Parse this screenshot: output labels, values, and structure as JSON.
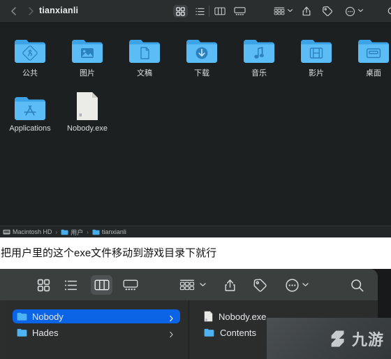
{
  "top_window": {
    "toolbar": {
      "back_icon": "chevron-left-icon",
      "forward_icon": "chevron-right-icon",
      "title": "tianxianli",
      "buttons": [
        {
          "name": "icon-view-button",
          "icon": "grid-view-icon",
          "selected": true
        },
        {
          "name": "list-view-button",
          "icon": "list-view-icon",
          "selected": false
        },
        {
          "name": "column-view-button",
          "icon": "column-view-icon",
          "selected": false
        },
        {
          "name": "gallery-view-button",
          "icon": "gallery-view-icon",
          "selected": false
        },
        {
          "name": "group-by-button",
          "icon": "group-by-icon",
          "selected": false
        },
        {
          "name": "share-button",
          "icon": "share-icon",
          "selected": false
        },
        {
          "name": "tag-button",
          "icon": "tag-icon",
          "selected": false
        },
        {
          "name": "more-button",
          "icon": "ellipsis-circle-icon",
          "selected": false
        },
        {
          "name": "search-button",
          "icon": "search-icon",
          "selected": false
        }
      ]
    },
    "items_row1": [
      {
        "label": "公共",
        "icon": "folder-public-icon"
      },
      {
        "label": "图片",
        "icon": "folder-pictures-icon"
      },
      {
        "label": "文稿",
        "icon": "folder-documents-icon"
      },
      {
        "label": "下载",
        "icon": "folder-downloads-icon"
      },
      {
        "label": "音乐",
        "icon": "folder-music-icon"
      },
      {
        "label": "影片",
        "icon": "folder-movies-icon"
      },
      {
        "label": "桌面",
        "icon": "folder-desktop-icon"
      }
    ],
    "items_row2": [
      {
        "label": "Applications",
        "icon": "folder-applications-icon"
      },
      {
        "label": "Nobody.exe",
        "icon": "generic-document-icon"
      }
    ],
    "path_bar": [
      {
        "label": "Macintosh HD",
        "icon": "hard-disk-icon"
      },
      {
        "label": "用户",
        "icon": "folder-icon"
      },
      {
        "label": "tianxianli",
        "icon": "folder-icon"
      }
    ],
    "path_separator": "›"
  },
  "caption": {
    "text": "把用户里的这个exe文件移动到游戏目录下就行"
  },
  "bottom_window": {
    "toolbar": {
      "buttons": [
        {
          "name": "icon-view-button",
          "icon": "grid-view-icon",
          "selected": false
        },
        {
          "name": "list-view-button",
          "icon": "list-view-icon",
          "selected": false
        },
        {
          "name": "column-view-button",
          "icon": "column-view-icon",
          "selected": true
        },
        {
          "name": "gallery-view-button",
          "icon": "gallery-view-icon",
          "selected": false
        },
        {
          "name": "group-by-button",
          "icon": "group-by-icon",
          "selected": false
        },
        {
          "name": "share-button",
          "icon": "share-icon",
          "selected": false
        },
        {
          "name": "tag-button",
          "icon": "tag-icon",
          "selected": false
        },
        {
          "name": "more-button",
          "icon": "ellipsis-circle-icon",
          "selected": false
        },
        {
          "name": "search-button",
          "icon": "search-icon",
          "selected": false
        }
      ]
    },
    "column_one": [
      {
        "label": "Nobody",
        "icon": "folder-icon",
        "selected": true,
        "disclosure": "›"
      },
      {
        "label": "Hades",
        "icon": "folder-icon",
        "selected": false,
        "disclosure": "›"
      }
    ],
    "column_two": [
      {
        "label": "Nobody.exe",
        "icon": "generic-document-icon"
      },
      {
        "label": "Contents",
        "icon": "folder-icon"
      }
    ]
  },
  "watermark": {
    "text": "九游",
    "logo_icon": "jiuyou-logo-icon"
  },
  "colors": {
    "selection_blue": "#0b63e5",
    "folder_blue": "#55b7f2",
    "toolbar_dark": "#2b2e2f",
    "window_dark": "#1d2021",
    "bottom_toolbar": "#3b403f"
  }
}
